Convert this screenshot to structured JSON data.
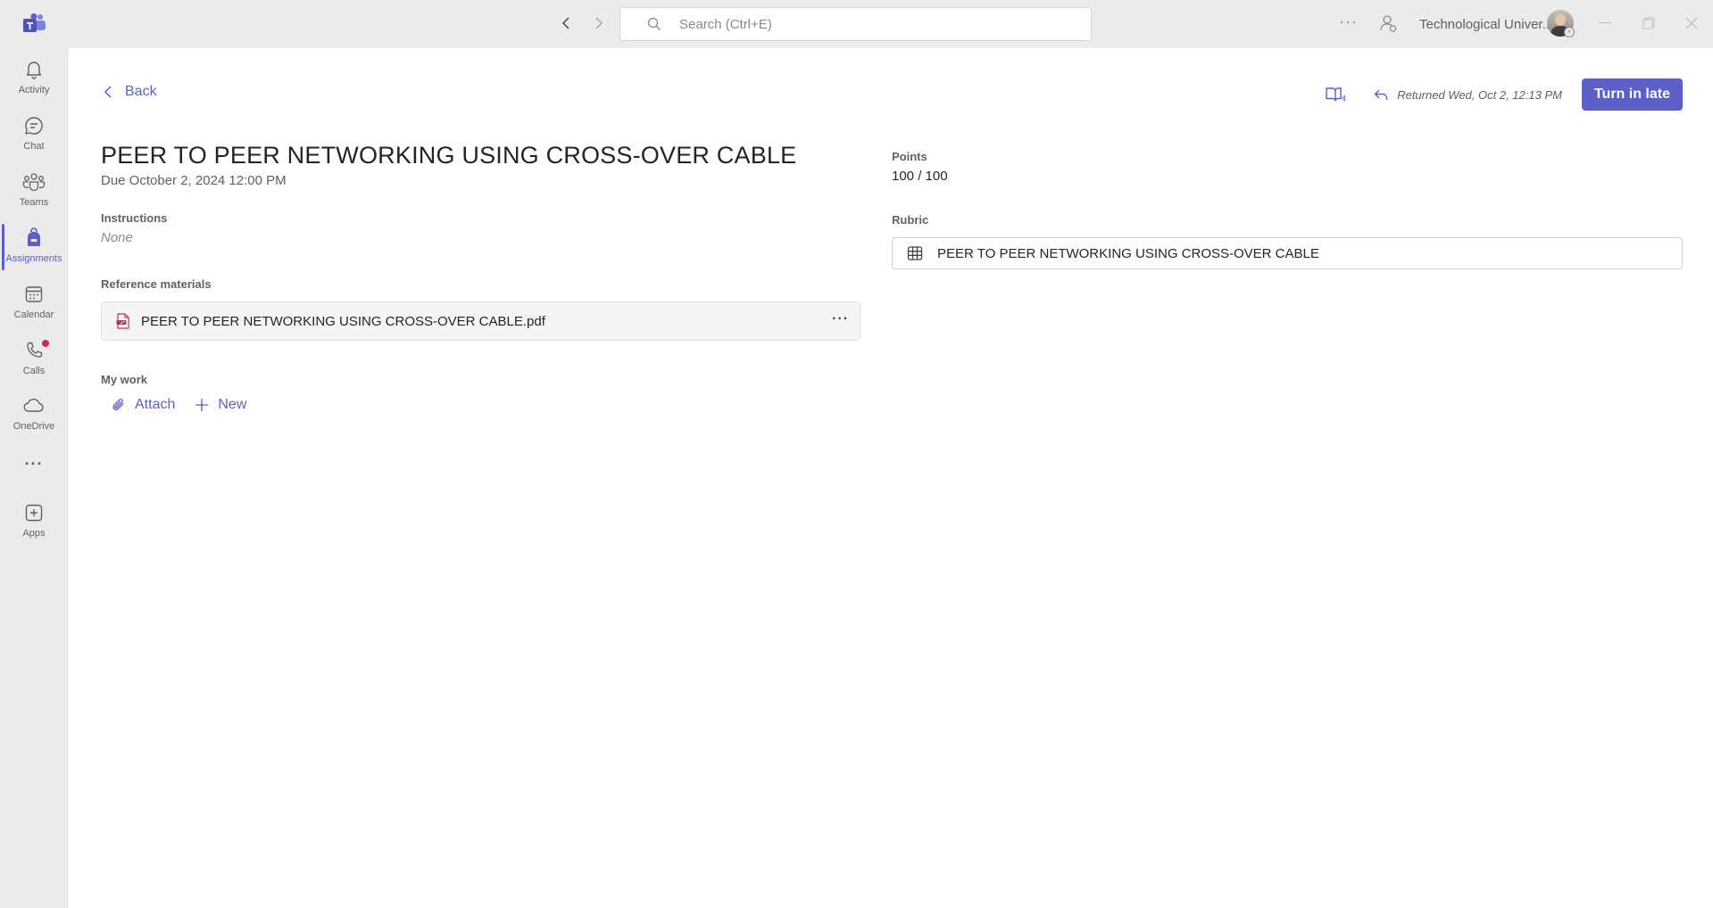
{
  "titlebar": {
    "search_placeholder": "Search (Ctrl+E)",
    "more_label": "···",
    "org_name": "Technological Univer..."
  },
  "rail": {
    "items": [
      {
        "label": "Activity",
        "icon": "bell-icon"
      },
      {
        "label": "Chat",
        "icon": "chat-icon"
      },
      {
        "label": "Teams",
        "icon": "teams-icon"
      },
      {
        "label": "Assignments",
        "icon": "backpack-icon",
        "active": true
      },
      {
        "label": "Calendar",
        "icon": "calendar-icon"
      },
      {
        "label": "Calls",
        "icon": "phone-icon",
        "badge": true
      },
      {
        "label": "OneDrive",
        "icon": "cloud-icon"
      }
    ],
    "more_label": "···",
    "apps_label": "Apps"
  },
  "header": {
    "back_label": "Back",
    "returned_text": "Returned Wed, Oct 2, 12:13 PM",
    "turn_in_label": "Turn in late"
  },
  "assignment": {
    "title": "PEER TO PEER NETWORKING USING CROSS-OVER CABLE",
    "due": "Due October 2, 2024 12:00 PM",
    "instructions_label": "Instructions",
    "instructions_value": "None",
    "reference_label": "Reference materials",
    "reference_file": "PEER TO PEER NETWORKING USING CROSS-OVER CABLE.pdf",
    "file_more": "···",
    "my_work_label": "My work",
    "attach_label": "Attach",
    "new_label": "New"
  },
  "grading": {
    "points_label": "Points",
    "points_value": "100 / 100",
    "rubric_label": "Rubric",
    "rubric_name": "PEER TO PEER NETWORKING USING CROSS-OVER CABLE"
  },
  "colors": {
    "accent": "#5b5fc7",
    "rail_bg": "#ebebeb",
    "content_bg": "#ffffff",
    "notification": "#c4314b"
  }
}
